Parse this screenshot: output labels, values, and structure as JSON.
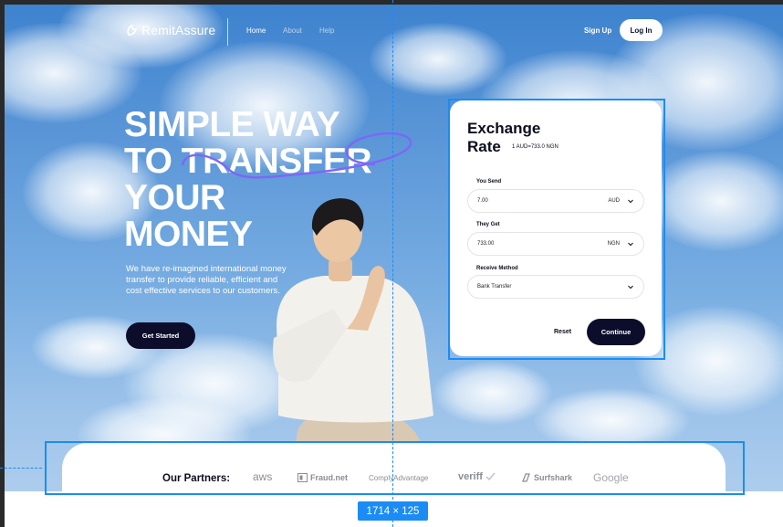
{
  "brand": {
    "name": "RemitAssure"
  },
  "nav": {
    "links": [
      {
        "label": "Home"
      },
      {
        "label": "About"
      },
      {
        "label": "Help"
      }
    ],
    "signup": "Sign Up",
    "login": "Log In"
  },
  "hero": {
    "title_lines": [
      "SIMPLE WAY",
      "TO TRANSFER",
      "YOUR",
      "MONEY"
    ],
    "subtitle": "We have re-imagined international money transfer to provide reliable, efficient and cost effective services to our customers.",
    "cta": "Get Started"
  },
  "exchange": {
    "title_line1": "Exchange",
    "title_line2": "Rate",
    "rate": "1 AUD=733.0 NGN",
    "you_send": {
      "label": "You Send",
      "value": "7.00",
      "currency": "AUD"
    },
    "they_get": {
      "label": "They Get",
      "value": "733.00",
      "currency": "NGN"
    },
    "receive_method": {
      "label": "Receive Method",
      "value": "Bank Transfer"
    },
    "reset": "Reset",
    "continue": "Continue"
  },
  "partners": {
    "label": "Our Partners:",
    "items": [
      {
        "name": "aws",
        "icon": "aws-logo"
      },
      {
        "name": "Fraud.net",
        "icon": "fraudnet-logo"
      },
      {
        "name": "ComplyAdvantage",
        "icon": "complyadvantage-logo"
      },
      {
        "name": "veriff",
        "icon": "veriff-logo"
      },
      {
        "name": "Surfshark",
        "icon": "surfshark-logo"
      },
      {
        "name": "Google",
        "icon": "google-logo"
      }
    ]
  },
  "design_tool": {
    "selection_size": "1714 × 125"
  },
  "colors": {
    "accent": "#1b8cf5",
    "dark_button": "#0c0d2b",
    "sky": "#5d98d8"
  }
}
